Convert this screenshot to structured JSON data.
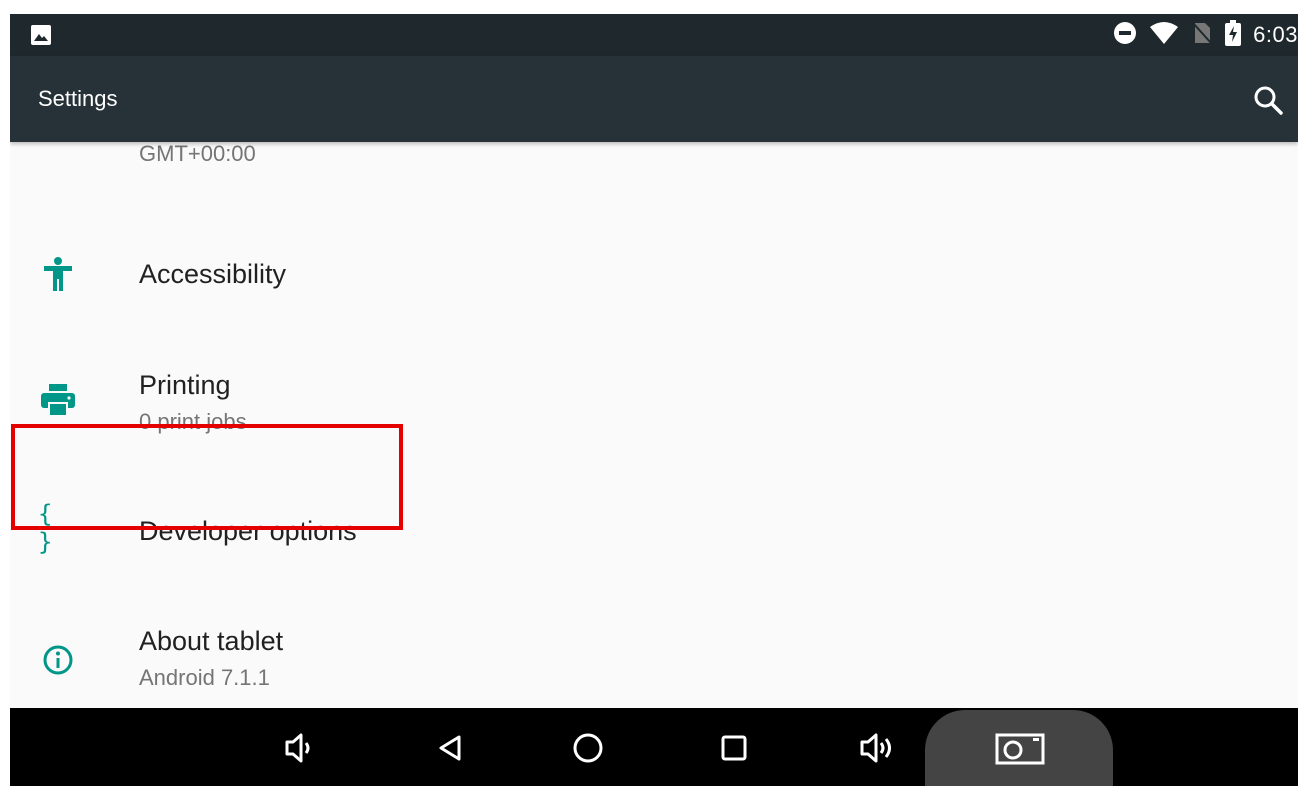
{
  "status_bar": {
    "time": "6:03",
    "icons": [
      "image-icon",
      "do-not-disturb-icon",
      "wifi-icon",
      "no-sim-icon",
      "battery-charging-icon"
    ]
  },
  "app_bar": {
    "title": "Settings",
    "search_icon": "search-icon"
  },
  "settings_list": [
    {
      "title": "",
      "subtitle": "GMT+00:00",
      "icon": "clock-icon"
    },
    {
      "title": "Accessibility",
      "subtitle": "",
      "icon": "accessibility-icon"
    },
    {
      "title": "Printing",
      "subtitle": "0 print jobs",
      "icon": "print-icon"
    },
    {
      "title": "Developer options",
      "subtitle": "",
      "icon": "braces-icon"
    },
    {
      "title": "About tablet",
      "subtitle": "Android 7.1.1",
      "icon": "info-icon"
    }
  ],
  "nav_bar": {
    "buttons": [
      "volume-down-icon",
      "back-icon",
      "home-icon",
      "recents-icon",
      "volume-up-icon",
      "screenshot-icon"
    ]
  },
  "colors": {
    "accent": "#009688",
    "app_bar": "#263238",
    "status_bar": "#1f292d",
    "highlight": "#e50000"
  }
}
